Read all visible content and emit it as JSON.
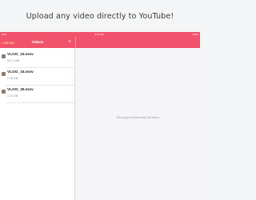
{
  "banner": {
    "headline": "Upload any video directly to YouTube!"
  },
  "statusbar": {
    "left": "iPad",
    "center": "9:41 AM",
    "right": "100%"
  },
  "navbar": {
    "back_label": "‹ Upload",
    "title": "Videos",
    "add_icon": "plus-icon",
    "add_glyph": "+"
  },
  "videos": [
    {
      "name": "VLOG_33.mov",
      "size": "537.1 MB"
    },
    {
      "name": "VLOG_34.mov",
      "size": "2.35 GB"
    },
    {
      "name": "VLOG_35.mov",
      "size": "1.04 GB"
    }
  ],
  "row_chevron": "›",
  "detail": {
    "empty_message": "This page intentionally left blank."
  },
  "colors": {
    "accent": "#f0536b",
    "back_label": "#ffe08a",
    "background": "#f5f5f7"
  }
}
